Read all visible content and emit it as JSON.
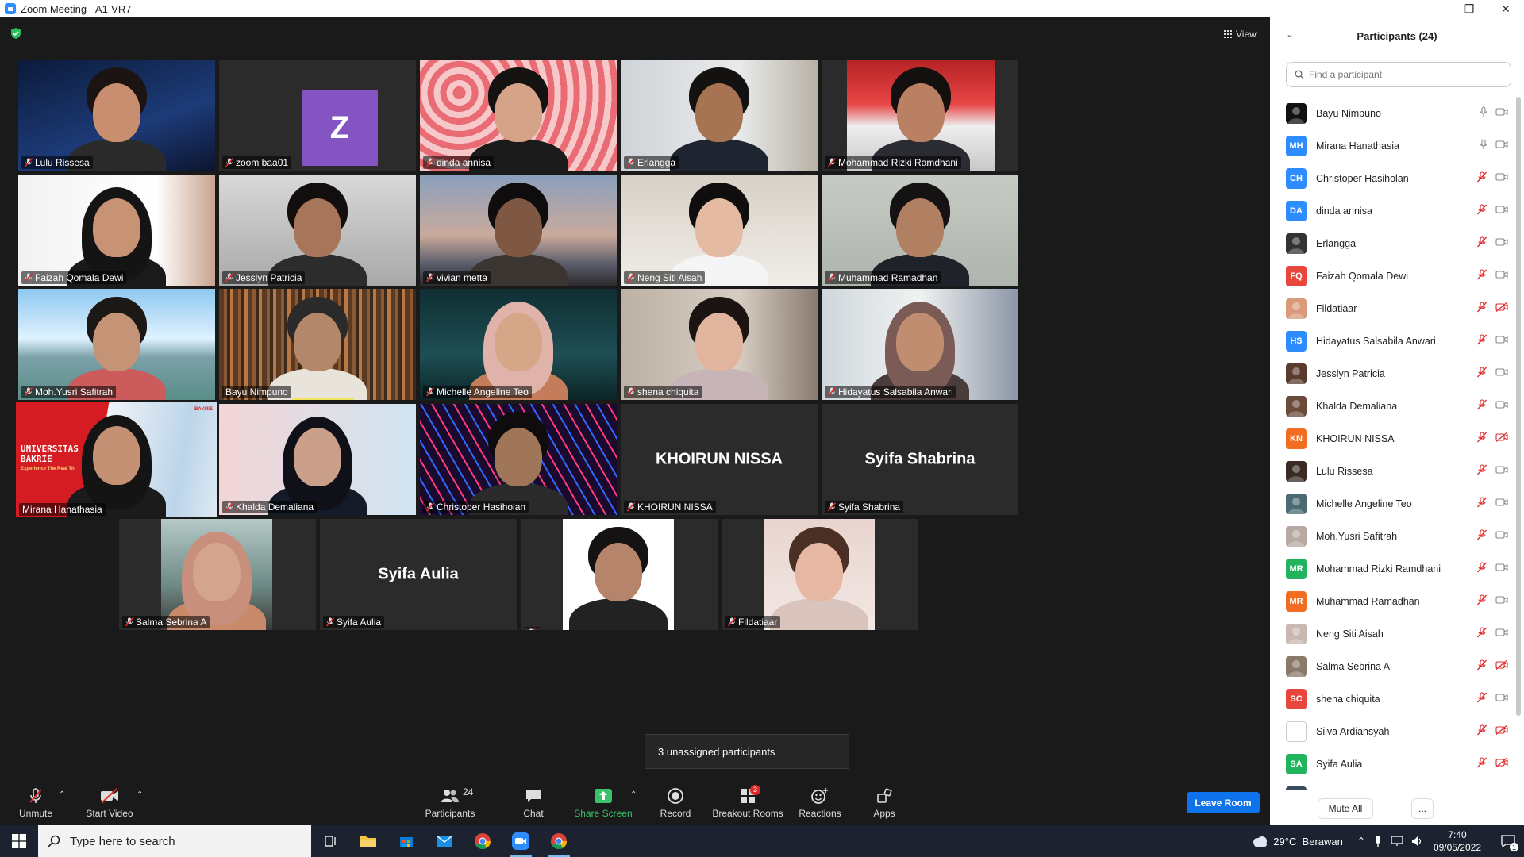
{
  "window": {
    "title": "Zoom Meeting - A1-VR7",
    "minimize": "—",
    "maximize": "❒",
    "close": "✕"
  },
  "view_label": "View",
  "tiles": [
    {
      "name": "Lulu Rissesa",
      "muted": true
    },
    {
      "name": "zoom baa01",
      "muted": true,
      "avatar_letter": "Z"
    },
    {
      "name": "dinda annisa",
      "muted": true
    },
    {
      "name": "Erlangga",
      "muted": true
    },
    {
      "name": "Mohammad Rizki Ramdhani",
      "muted": true
    },
    {
      "name": "Faizah Qomala Dewi",
      "muted": true
    },
    {
      "name": "Jesslyn Patricia",
      "muted": true
    },
    {
      "name": "vivian metta",
      "muted": true
    },
    {
      "name": "Neng Siti Aisah",
      "muted": true
    },
    {
      "name": "Muhammad Ramadhan",
      "muted": true
    },
    {
      "name": "Moh.Yusri Safitrah",
      "muted": true
    },
    {
      "name": "Bayu Nimpuno",
      "muted": false
    },
    {
      "name": "Michelle Angeline Teo",
      "muted": true
    },
    {
      "name": "shena chiquita",
      "muted": true
    },
    {
      "name": "Hidayatus Salsabila Anwari",
      "muted": true
    },
    {
      "name": "Mirana Hanathasia",
      "muted": false,
      "bg_line1": "UNIVERSITAS",
      "bg_line2": "BAKRIE",
      "bg_line3": "Experience The Real Th",
      "bg_logo": "BAKRIE"
    },
    {
      "name": "Khalda Demaliana",
      "muted": true
    },
    {
      "name": "Christoper Hasiholan",
      "muted": true
    },
    {
      "name": "KHOIRUN NISSA",
      "muted": true,
      "big_name": "KHOIRUN NISSA"
    },
    {
      "name": "Syifa Shabrina",
      "muted": true,
      "big_name": "Syifa Shabrina"
    },
    {
      "name": "Salma Sebrina A",
      "muted": true
    },
    {
      "name": "Syifa Aulia",
      "muted": true,
      "big_name": "Syifa Aulia"
    },
    {
      "name": "",
      "muted": true
    },
    {
      "name": "Fildatiaar",
      "muted": true
    }
  ],
  "tooltip": "3 unassigned participants",
  "toolbar": {
    "unmute": "Unmute",
    "start_video": "Start Video",
    "participants": "Participants",
    "participants_count": "24",
    "chat": "Chat",
    "share_screen": "Share Screen",
    "record": "Record",
    "breakout_rooms": "Breakout Rooms",
    "breakout_badge": "3",
    "reactions": "Reactions",
    "apps": "Apps",
    "leave_room": "Leave Room"
  },
  "panel": {
    "title": "Participants (24)",
    "search_placeholder": "Find a participant",
    "mute_all": "Mute All",
    "more": "..."
  },
  "participants": [
    {
      "name": "Bayu Nimpuno",
      "initials": "",
      "color": "#111111",
      "mic": "on",
      "video": "on"
    },
    {
      "name": "Mirana Hanathasia",
      "initials": "MH",
      "color": "#2d8cff",
      "mic": "on",
      "video": "on"
    },
    {
      "name": "Christoper Hasiholan",
      "initials": "CH",
      "color": "#2d8cff",
      "mic": "off",
      "video": "on"
    },
    {
      "name": "dinda annisa",
      "initials": "DA",
      "color": "#2d8cff",
      "mic": "off",
      "video": "on"
    },
    {
      "name": "Erlangga",
      "initials": "",
      "color": "#333333",
      "mic": "off",
      "video": "on"
    },
    {
      "name": "Faizah Qomala Dewi",
      "initials": "FQ",
      "color": "#e8453c",
      "mic": "off",
      "video": "on"
    },
    {
      "name": "Fildatiaar",
      "initials": "",
      "color": "#d89a7a",
      "mic": "off",
      "video": "off"
    },
    {
      "name": "Hidayatus Salsabila Anwari",
      "initials": "HS",
      "color": "#2d8cff",
      "mic": "off",
      "video": "on"
    },
    {
      "name": "Jesslyn Patricia",
      "initials": "",
      "color": "#5a3b2e",
      "mic": "off",
      "video": "on"
    },
    {
      "name": "Khalda Demaliana",
      "initials": "",
      "color": "#6b4c3b",
      "mic": "off",
      "video": "on"
    },
    {
      "name": "KHOIRUN NISSA",
      "initials": "KN",
      "color": "#f26d21",
      "mic": "off",
      "video": "off"
    },
    {
      "name": "Lulu Rissesa",
      "initials": "",
      "color": "#3a2a24",
      "mic": "off",
      "video": "on"
    },
    {
      "name": "Michelle Angeline Teo",
      "initials": "",
      "color": "#4c6a72",
      "mic": "off",
      "video": "on"
    },
    {
      "name": "Moh.Yusri Safitrah",
      "initials": "",
      "color": "#b8a9a2",
      "mic": "off",
      "video": "on"
    },
    {
      "name": "Mohammad Rizki Ramdhani",
      "initials": "MR",
      "color": "#22b35e",
      "mic": "off",
      "video": "on"
    },
    {
      "name": "Muhammad Ramadhan",
      "initials": "MR",
      "color": "#f26d21",
      "mic": "off",
      "video": "on"
    },
    {
      "name": "Neng Siti Aisah",
      "initials": "",
      "color": "#c9b7b0",
      "mic": "off",
      "video": "on"
    },
    {
      "name": "Salma Sebrina A",
      "initials": "",
      "color": "#8a7a6a",
      "mic": "off",
      "video": "off"
    },
    {
      "name": "shena chiquita",
      "initials": "SC",
      "color": "#e8453c",
      "mic": "off",
      "video": "on"
    },
    {
      "name": "Silva Ardiansyah",
      "initials": "",
      "color": "#ffffff",
      "mic": "off",
      "video": "off"
    },
    {
      "name": "Syifa Aulia",
      "initials": "SA",
      "color": "#22b35e",
      "mic": "off",
      "video": "off"
    },
    {
      "name": "",
      "initials": "",
      "color": "#3a4a5a",
      "mic": "off",
      "video": "off"
    }
  ],
  "taskbar": {
    "search_placeholder": "Type here to search",
    "weather": "29°C  Berawan",
    "time": "7:40",
    "date": "09/05/2022",
    "notifications": "1"
  },
  "colors": {
    "accent": "#0e72ed",
    "active_speaker": "#f2e35d",
    "muted_red": "#e02828",
    "share_green": "#3ac26a"
  }
}
